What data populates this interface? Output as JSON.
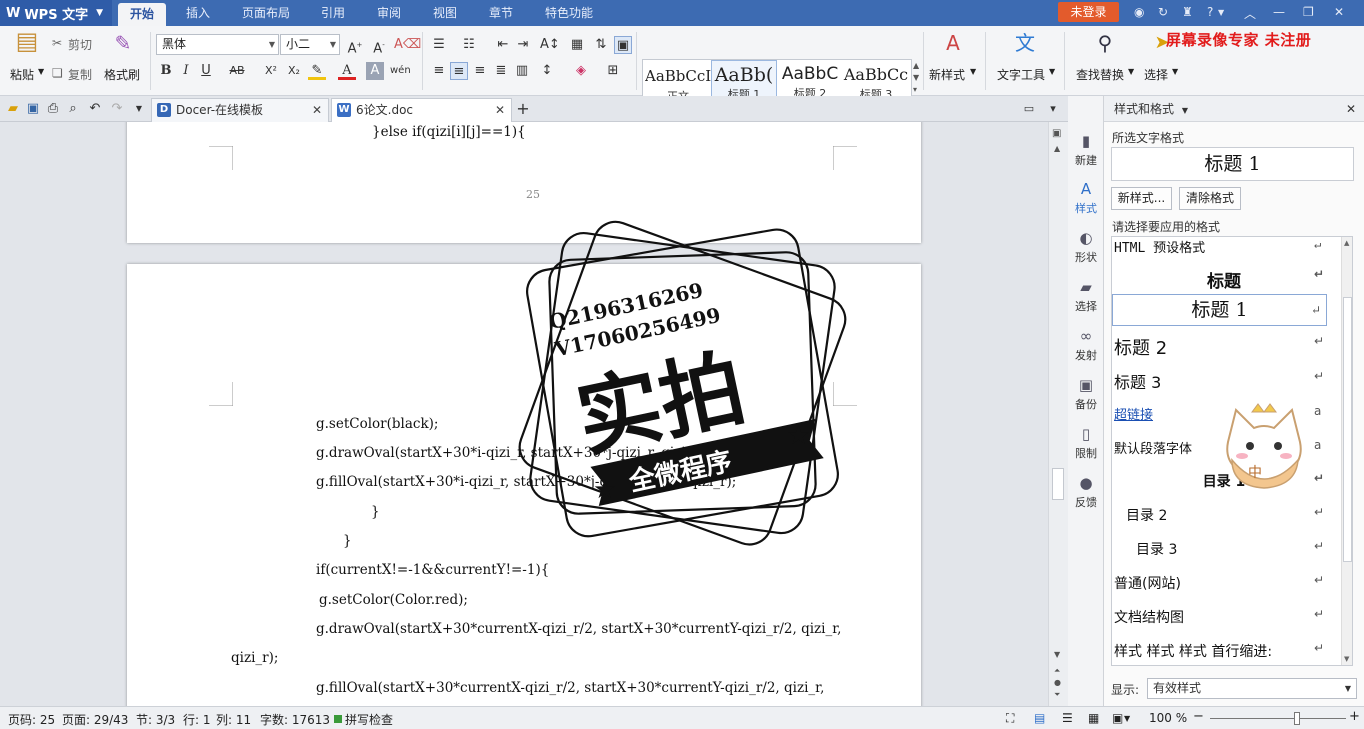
{
  "titlebar": {
    "app_name": "WPS 文字",
    "tabs": [
      "开始",
      "插入",
      "页面布局",
      "引用",
      "审阅",
      "视图",
      "章节",
      "特色功能"
    ],
    "login_label": "未登录",
    "help_label": "?"
  },
  "ribbon": {
    "paste_label": "粘贴",
    "cut_label": "剪切",
    "copy_label": "复制",
    "format_painter_label": "格式刷",
    "font_name": "黑体",
    "font_size": "小二",
    "bold": "B",
    "italic": "I",
    "underline": "U",
    "strike": "AB",
    "superscript": "X²",
    "subscript": "X₂",
    "styles": [
      {
        "preview": "AaBbCcI",
        "label": "正文"
      },
      {
        "preview": "AaBb(",
        "label": "标题 1"
      },
      {
        "preview": "AaBbC",
        "label": "标题 2"
      },
      {
        "preview": "AaBbCc",
        "label": "标题 3"
      }
    ],
    "new_style_label": "新样式",
    "text_tools_label": "文字工具",
    "find_replace_label": "查找替换",
    "select_label": "选择",
    "watermark_text": "屏幕录像专家 未注册"
  },
  "tabs": {
    "tab1": "Docer-在线模板",
    "tab2": "6论文.doc",
    "add": "+"
  },
  "document": {
    "page_top_line": "}else if(qizi[i][j]==1){",
    "page_number": "25",
    "lines": [
      "g.setColor(black);",
      "g.drawOval(startX+30*i-qizi_r, startX+30*j-qizi_r, qizi_r, qizi_r);",
      "g.fillOval(startX+30*i-qizi_r, startX+30*j-qizi_r, qizi_r, qizi_r);",
      "}",
      "}",
      "if(currentX!=-1&&currentY!=-1){",
      "g.setColor(Color.red);",
      "g.drawOval(startX+30*currentX-qizi_r/2,    startX+30*currentY-qizi_r/2,    qizi_r,",
      "qizi_r);",
      "g.fillOval(startX+30*currentX-qizi_r/2,    startX+30*currentY-qizi_r/2,    qizi_r,"
    ]
  },
  "overlay_stamp": {
    "line1": "Q2196316269",
    "line2": "V17060256499",
    "main": "实拍",
    "ribbon": "全微程序"
  },
  "mascot_text": "中",
  "sidestrip": [
    "新建",
    "样式",
    "形状",
    "选择",
    "发射",
    "备份",
    "限制",
    "反馈"
  ],
  "pane": {
    "title": "样式和格式",
    "selected_label": "所选文字格式",
    "current_style": "标题 1",
    "new_style_btn": "新样式...",
    "clear_btn": "清除格式",
    "apply_label": "请选择要应用的格式",
    "styles": [
      "HTML 预设格式",
      "标题",
      "标题 1",
      "标题 2",
      "标题 3",
      "超链接",
      "默认段落字体",
      "目录 1",
      "目录 2",
      "目录 3",
      "普通(网站)",
      "文档结构图",
      "样式 样式 样式 首行缩进:"
    ],
    "show_label": "显示:",
    "show_value": "有效样式"
  },
  "status": {
    "page_num": "页码: 25",
    "pages": "页面: 29/43",
    "section": "节: 3/3",
    "row": "行: 1",
    "col": "列: 11",
    "words": "字数: 17613",
    "spell": "拼写检查",
    "zoom": "100 %",
    "zoom_level": 0.64
  },
  "colors": {
    "title_blue": "#3d6bb2",
    "login_orange": "#e35b2c",
    "watermark_red": "#e21c1c"
  }
}
